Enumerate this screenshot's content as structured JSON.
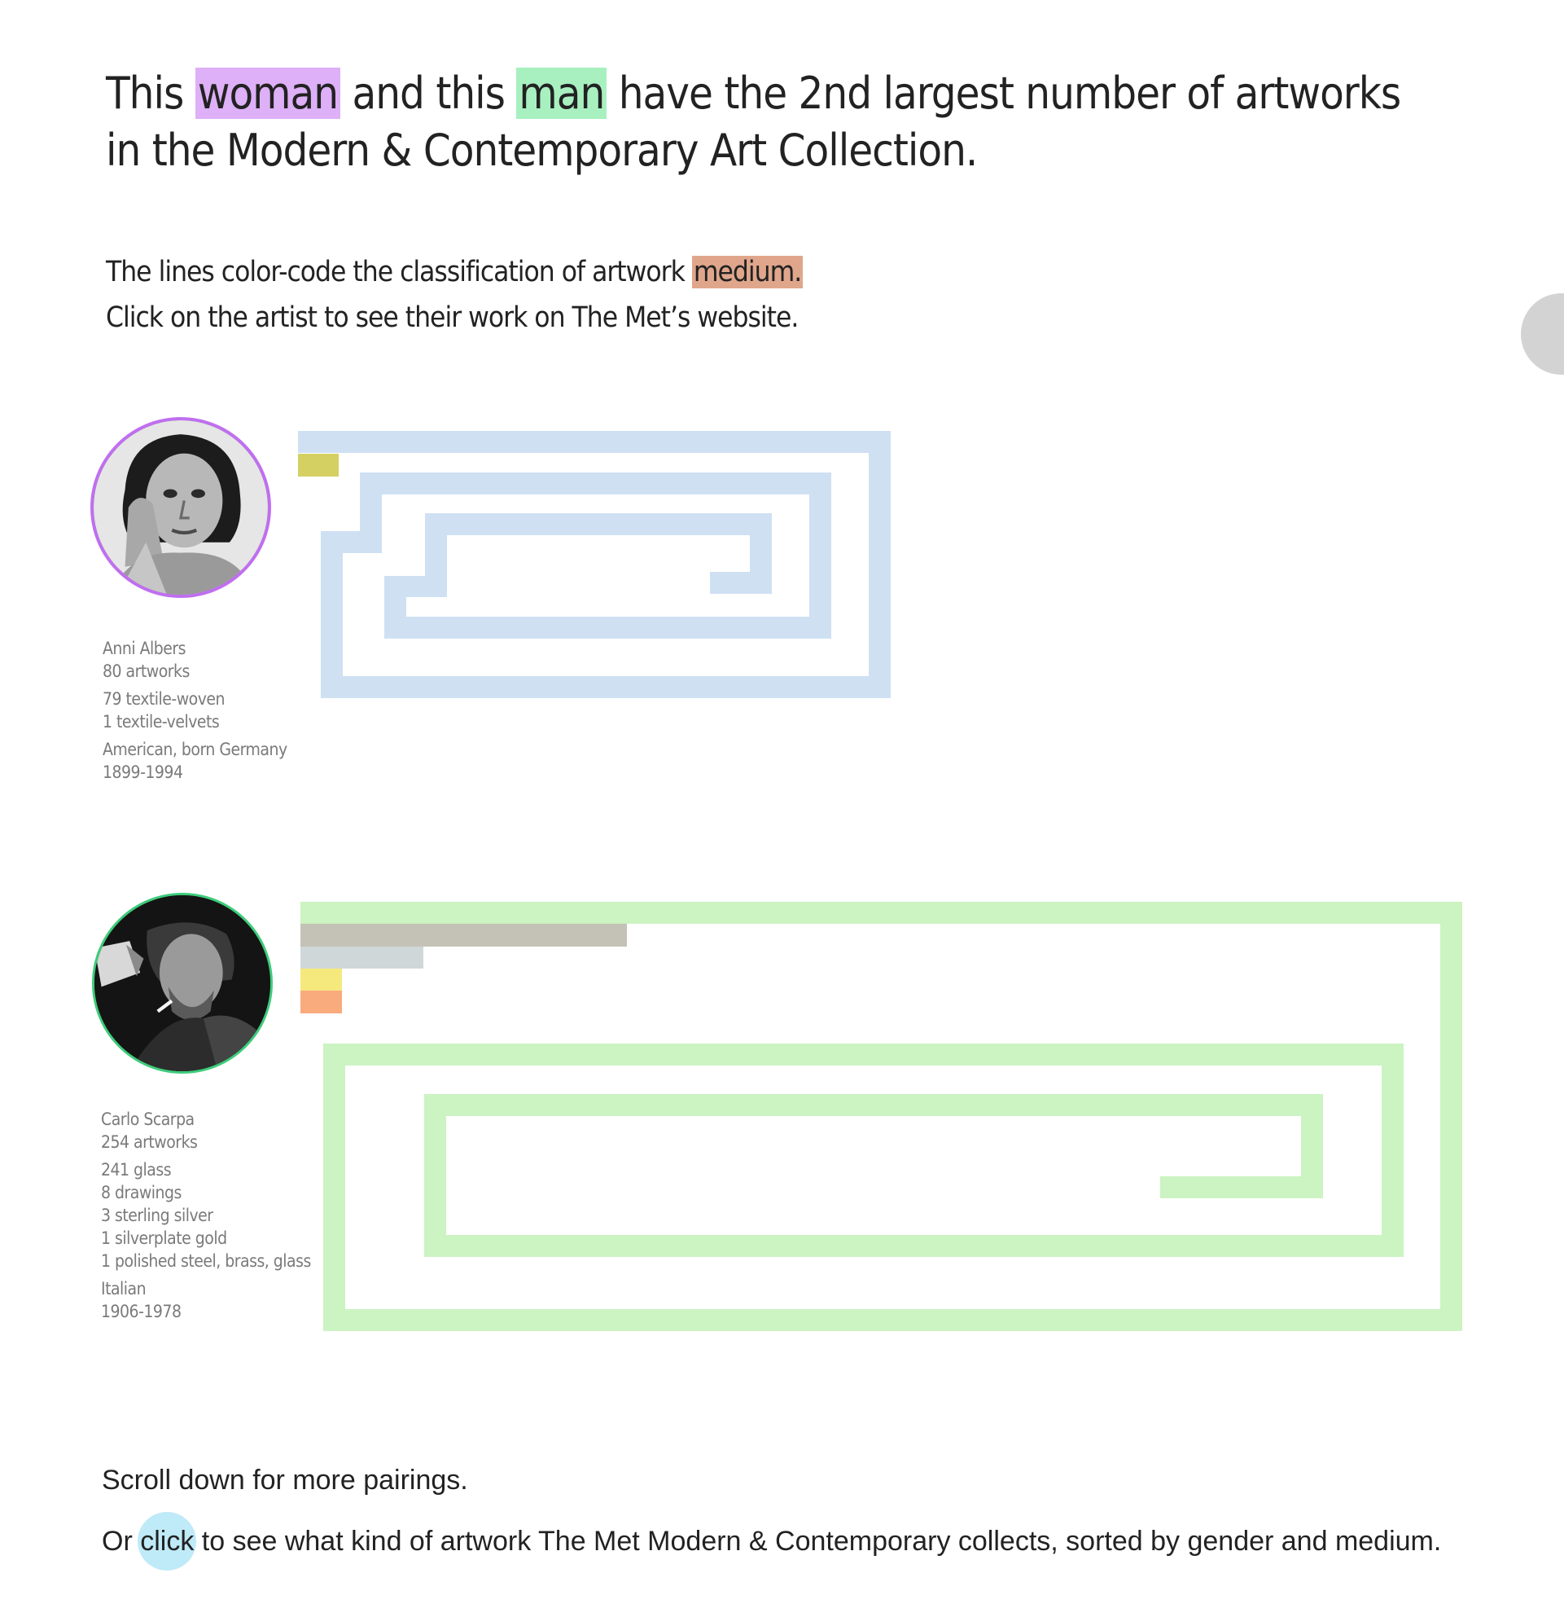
{
  "headline": {
    "part1": "This ",
    "woman": "woman",
    "part2": " and this ",
    "man": "man",
    "part3": " have the 2nd largest number of artworks in the Modern & Contemporary Art Collection."
  },
  "intro": {
    "line1_text": "The lines color-code the classification of artwork ",
    "line1_highlight": "medium.",
    "line2": "Click on the artist to see their work on The Met’s website."
  },
  "artists": [
    {
      "name": "Anni Albers",
      "count": "80 artworks",
      "media": [
        "79 textile-woven",
        "1 textile-velvets"
      ],
      "nationality": "American, born Germany",
      "dates": "1899-1994",
      "ring_color": "#c06ff0",
      "maze_color": "#cfe0f3"
    },
    {
      "name": "Carlo Scarpa",
      "count": "254 artworks",
      "media": [
        "241 glass",
        "8 drawings",
        "3 sterling silver",
        "1 silverplate gold",
        "1 polished steel, brass, glass"
      ],
      "nationality": "Italian",
      "dates": "1906-1978",
      "ring_color": "#3dcc7a",
      "maze_color": "#ccf3c2"
    }
  ],
  "medium_colors": {
    "textile_velvets": "#d4d061",
    "drawings": "#c4c1b6",
    "sterling_silver": "#d0d7d8",
    "silverplate_gold": "#f5e97e",
    "polished_steel": "#f9ab7d"
  },
  "footer": {
    "scroll": "Scroll down for more pairings.",
    "or": "Or ",
    "click": "click",
    "rest": " to see what kind of artwork The Met Modern & Contemporary collects, sorted by gender and medium."
  }
}
